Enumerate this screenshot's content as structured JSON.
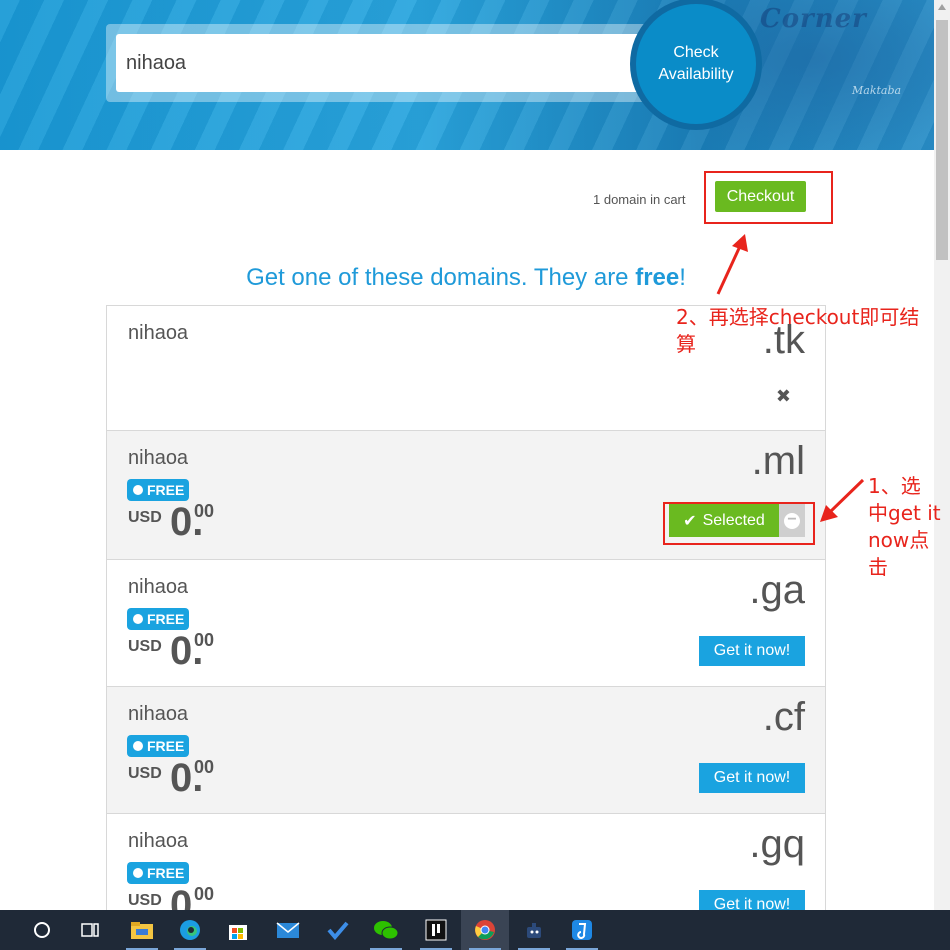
{
  "search": {
    "value": "nihaoa",
    "button_line1": "Check",
    "button_line2": "Availability"
  },
  "cart": {
    "count_text": "1 domain in cart",
    "checkout_label": "Checkout"
  },
  "headline": {
    "prefix": "Get one of these domains. They are ",
    "emphasis": "free",
    "suffix": "!"
  },
  "domains": [
    {
      "name": "nihaoa",
      "tld": ".tk",
      "state": "removed",
      "remove_glyph": "✖"
    },
    {
      "name": "nihaoa",
      "tld": ".ml",
      "state": "selected",
      "badge": "FREE",
      "currency": "USD",
      "price_int": "0.",
      "price_dec": "00",
      "button": "Selected"
    },
    {
      "name": "nihaoa",
      "tld": ".ga",
      "state": "available",
      "badge": "FREE",
      "currency": "USD",
      "price_int": "0.",
      "price_dec": "00",
      "button": "Get it now!"
    },
    {
      "name": "nihaoa",
      "tld": ".cf",
      "state": "available",
      "badge": "FREE",
      "currency": "USD",
      "price_int": "0.",
      "price_dec": "00",
      "button": "Get it now!"
    },
    {
      "name": "nihaoa",
      "tld": ".gq",
      "state": "available",
      "badge": "FREE",
      "currency": "USD",
      "price_int": "0.",
      "price_dec": "00",
      "button": "Get it now!"
    }
  ],
  "annotations": {
    "step1_lines": [
      "1、选",
      "中get it",
      "now点",
      "击"
    ],
    "step2_lines": [
      "2、再选择checkout即可结",
      "算"
    ],
    "color": "#e8241c"
  },
  "banner": {
    "signage": "Corner",
    "signage_small": "Maktaba"
  },
  "taskbar": {
    "icons": [
      "cortana-icon",
      "task-view-icon",
      "file-explorer-icon",
      "edge-icon",
      "store-icon",
      "mail-icon",
      "todo-icon",
      "wechat-icon",
      "notion-icon",
      "chrome-icon",
      "app-icon",
      "dingtalk-icon"
    ]
  },
  "colors": {
    "brand_blue": "#1aa3e0",
    "checkout_green": "#6aba20",
    "taskbar": "#1f2937"
  }
}
